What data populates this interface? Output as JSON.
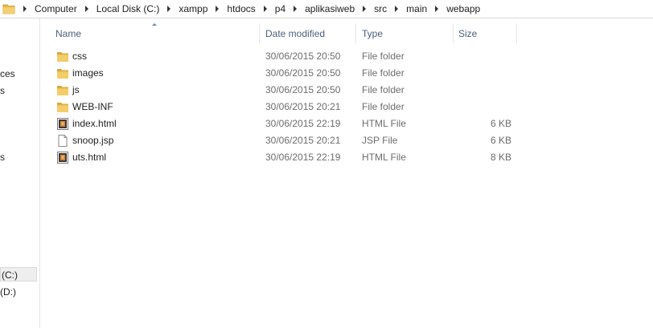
{
  "address_bar": {
    "crumbs": [
      "Computer",
      "Local Disk (C:)",
      "xampp",
      "htdocs",
      "p4",
      "aplikasiweb",
      "src",
      "main",
      "webapp"
    ]
  },
  "nav_pane": {
    "items": [
      {
        "label": "ces"
      },
      {
        "label": "s"
      },
      {
        "label": "s"
      },
      {
        "label": "(C:)",
        "selected": true
      },
      {
        "label": "(D:)"
      }
    ]
  },
  "columns": {
    "name": "Name",
    "date": "Date modified",
    "type": "Type",
    "size": "Size"
  },
  "files": [
    {
      "name": "css",
      "date": "30/06/2015 20:50",
      "type": "File folder",
      "size": "",
      "icon": "folder-icon"
    },
    {
      "name": "images",
      "date": "30/06/2015 20:50",
      "type": "File folder",
      "size": "",
      "icon": "folder-icon"
    },
    {
      "name": "js",
      "date": "30/06/2015 20:50",
      "type": "File folder",
      "size": "",
      "icon": "folder-icon"
    },
    {
      "name": "WEB-INF",
      "date": "30/06/2015 20:21",
      "type": "File folder",
      "size": "",
      "icon": "folder-icon"
    },
    {
      "name": "index.html",
      "date": "30/06/2015 22:19",
      "type": "HTML File",
      "size": "6 KB",
      "icon": "html-file-icon"
    },
    {
      "name": "snoop.jsp",
      "date": "30/06/2015 20:21",
      "type": "JSP File",
      "size": "6 KB",
      "icon": "blank-file-icon"
    },
    {
      "name": "uts.html",
      "date": "30/06/2015 22:19",
      "type": "HTML File",
      "size": "8 KB",
      "icon": "html-file-icon"
    }
  ],
  "colors": {
    "header_text": "#4c607a",
    "folder_yellow": "#e8b84a",
    "border": "#dadada"
  }
}
